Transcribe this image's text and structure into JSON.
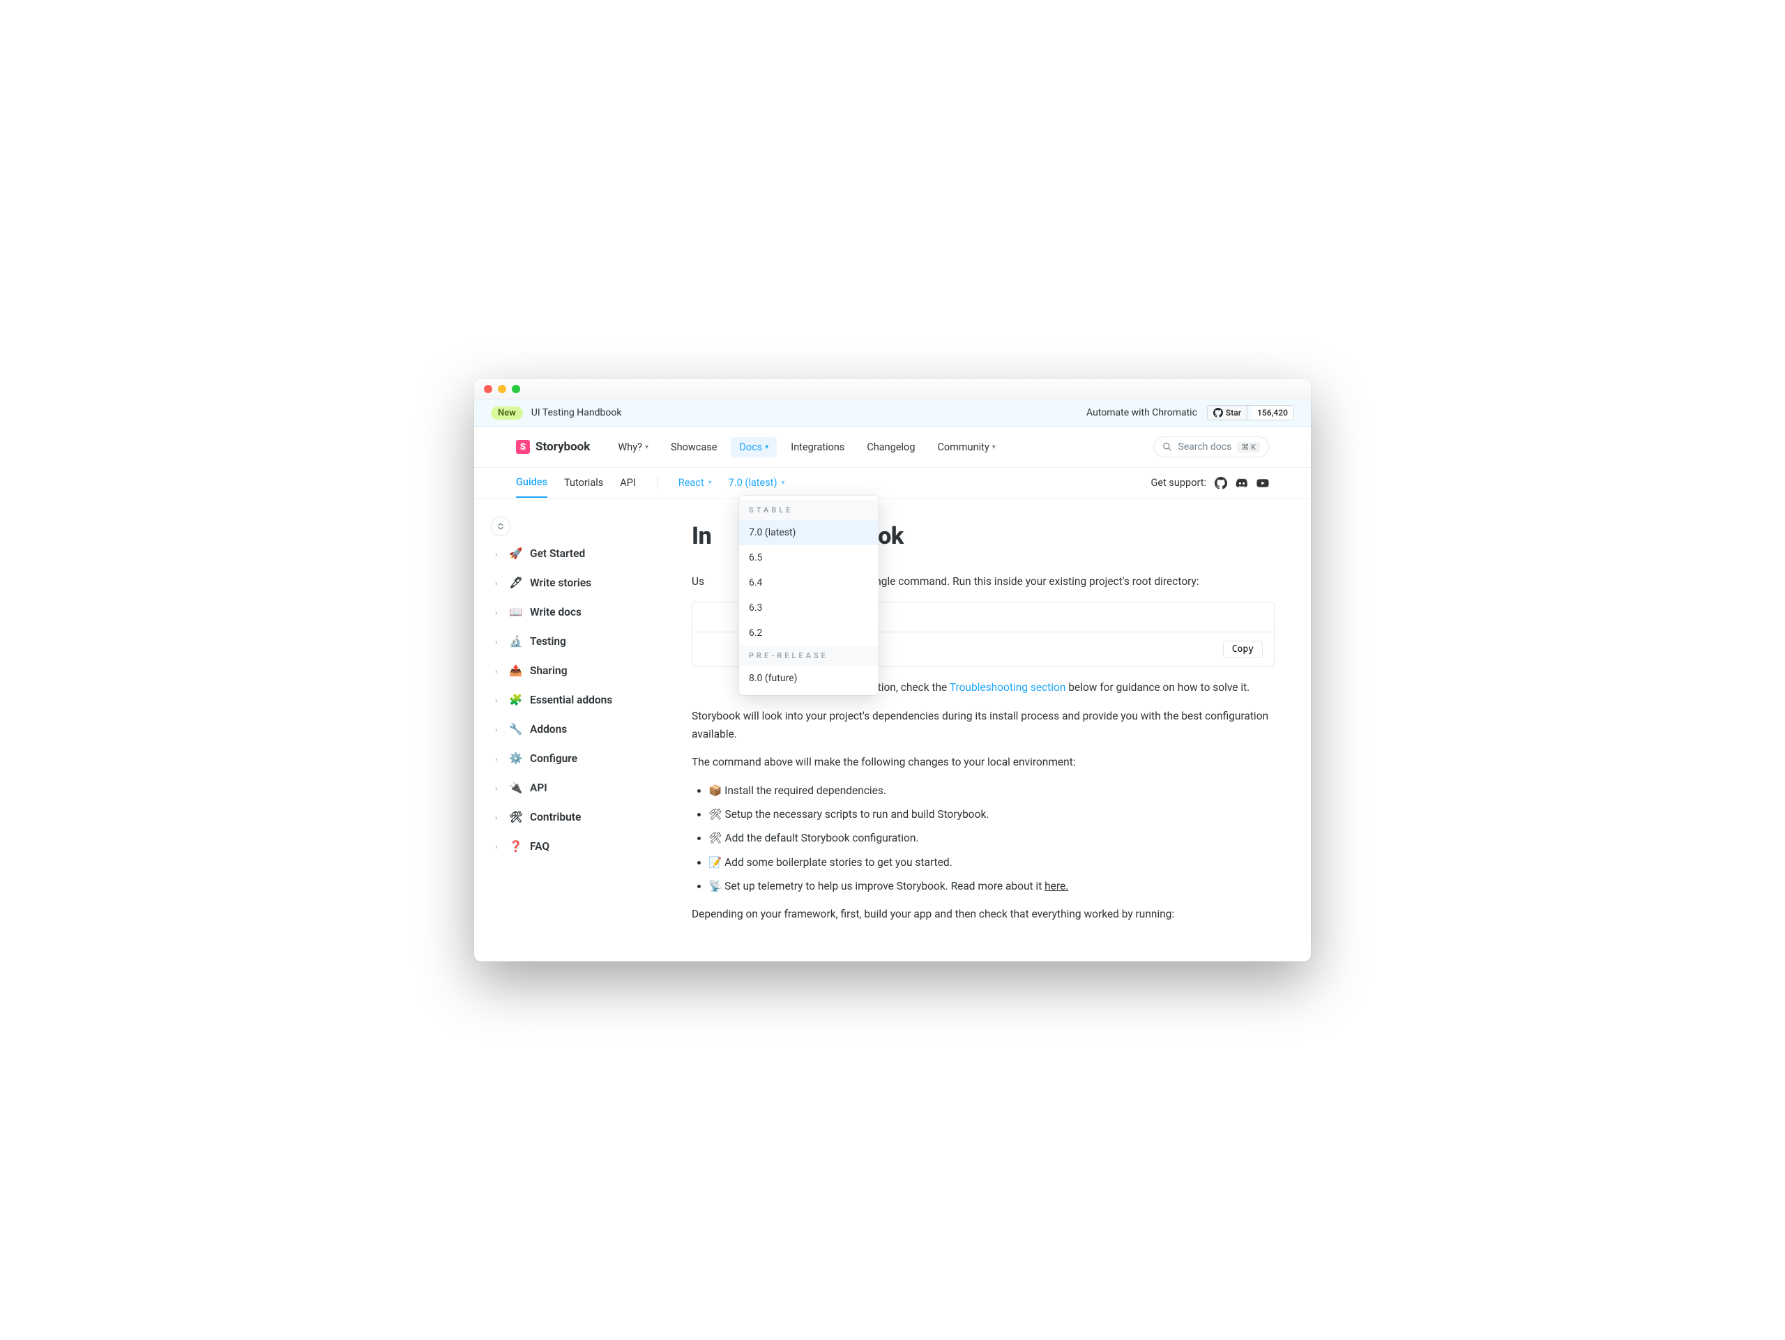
{
  "banner": {
    "badge": "New",
    "title": "UI Testing Handbook",
    "chromatic": "Automate with Chromatic",
    "github_star": "Star",
    "github_count": "156,420"
  },
  "brand": "Storybook",
  "nav": {
    "why": "Why?",
    "showcase": "Showcase",
    "docs": "Docs",
    "integrations": "Integrations",
    "changelog": "Changelog",
    "community": "Community"
  },
  "search": {
    "placeholder": "Search docs",
    "kbd": "⌘ K"
  },
  "subnav": {
    "guides": "Guides",
    "tutorials": "Tutorials",
    "api": "API",
    "framework": "React",
    "version": "7.0 (latest)",
    "support": "Get support:"
  },
  "dropdown": {
    "stable_heading": "STABLE",
    "prerelease_heading": "PRE-RELEASE",
    "items_stable": [
      "7.0 (latest)",
      "6.5",
      "6.4",
      "6.3",
      "6.2"
    ],
    "items_pre": [
      "8.0 (future)"
    ]
  },
  "sidebar": [
    {
      "emoji": "🚀",
      "label": "Get Started"
    },
    {
      "emoji": "🖋",
      "label": "Write stories"
    },
    {
      "emoji": "📖",
      "label": "Write docs"
    },
    {
      "emoji": "🔬",
      "label": "Testing"
    },
    {
      "emoji": "📤",
      "label": "Sharing"
    },
    {
      "emoji": "🧩",
      "label": "Essential addons"
    },
    {
      "emoji": "🔧",
      "label": "Addons"
    },
    {
      "emoji": "⚙️",
      "label": "Configure"
    },
    {
      "emoji": "🔌",
      "label": "API"
    },
    {
      "emoji": "🛠",
      "label": "Contribute"
    },
    {
      "emoji": "❓",
      "label": "FAQ"
    }
  ],
  "content": {
    "heading_partial": "In                              ok",
    "p1": "Us                                                  it in a single command. Run this inside your existing project's root directory:",
    "copy": "Copy",
    "p2_pre": "                                                               allation, check the ",
    "p2_link": "Troubleshooting section",
    "p2_post": " below for guidance on how to solve it.",
    "p3": "Storybook will look into your project's dependencies during its install process and provide you with the best configuration available.",
    "p4": "The command above will make the following changes to your local environment:",
    "bullets": [
      {
        "e": "📦",
        "t": "Install the required dependencies."
      },
      {
        "e": "🛠",
        "t": "Setup the necessary scripts to run and build Storybook."
      },
      {
        "e": "🛠",
        "t": "Add the default Storybook configuration."
      },
      {
        "e": "📝",
        "t": "Add some boilerplate stories to get you started."
      },
      {
        "e": "📡",
        "t": "Set up telemetry to help us improve Storybook. Read more about it "
      }
    ],
    "bullet_here": "here.",
    "p5": "Depending on your framework, first, build your app and then check that everything worked by running:"
  }
}
